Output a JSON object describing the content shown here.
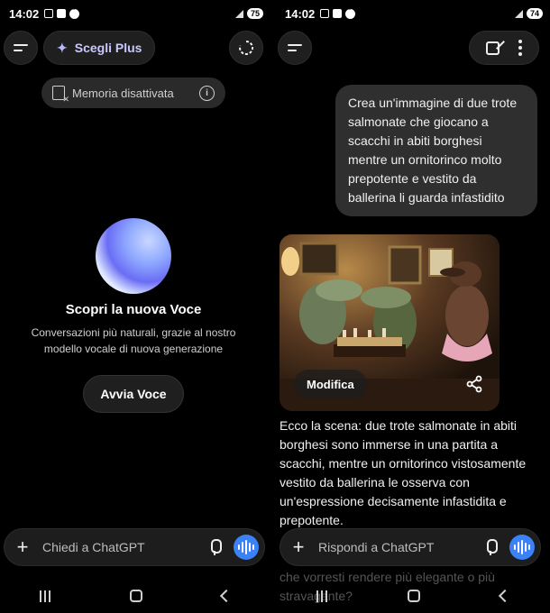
{
  "left": {
    "status": {
      "time": "14:02",
      "battery": "75"
    },
    "plus_label": "Scegli Plus",
    "memory_label": "Memoria disattivata",
    "voice_title": "Scopri la nuova Voce",
    "voice_sub": "Conversazioni più naturali, grazie al nostro modello vocale di nuova generazione",
    "voice_btn": "Avvia Voce",
    "input_placeholder": "Chiedi a ChatGPT"
  },
  "right": {
    "status": {
      "time": "14:02",
      "battery": "74"
    },
    "user_message": "Crea un'immagine di due trote salmonate che giocano a scacchi in abiti borghesi mentre un ornitorinco molto prepotente e vestito da ballerina li guarda infastidito",
    "modifica_label": "Modifica",
    "reply": "Ecco la scena: due trote salmonate in abiti borghesi sono immerse in una partita a scacchi, mentre un ornitorinco vistosamente vestito da ballerina le osserva con un'espressione decisamente infastidita e prepotente.",
    "faded": "che vorresti rendere più elegante o più stravagante?",
    "input_placeholder": "Rispondi a ChatGPT"
  },
  "icons": {
    "menu": "menu-icon",
    "sparkle": "sparkle-icon",
    "refresh": "refresh-icon",
    "memory_off": "memory-off-icon",
    "info": "info-icon",
    "plus": "plus-icon",
    "mic": "mic-icon",
    "voice_wave": "voice-wave-icon",
    "edit": "new-chat-icon",
    "more": "more-icon",
    "share": "share-icon"
  },
  "colors": {
    "accent": "#3b82f6",
    "plus_text": "#c8c8ff"
  }
}
